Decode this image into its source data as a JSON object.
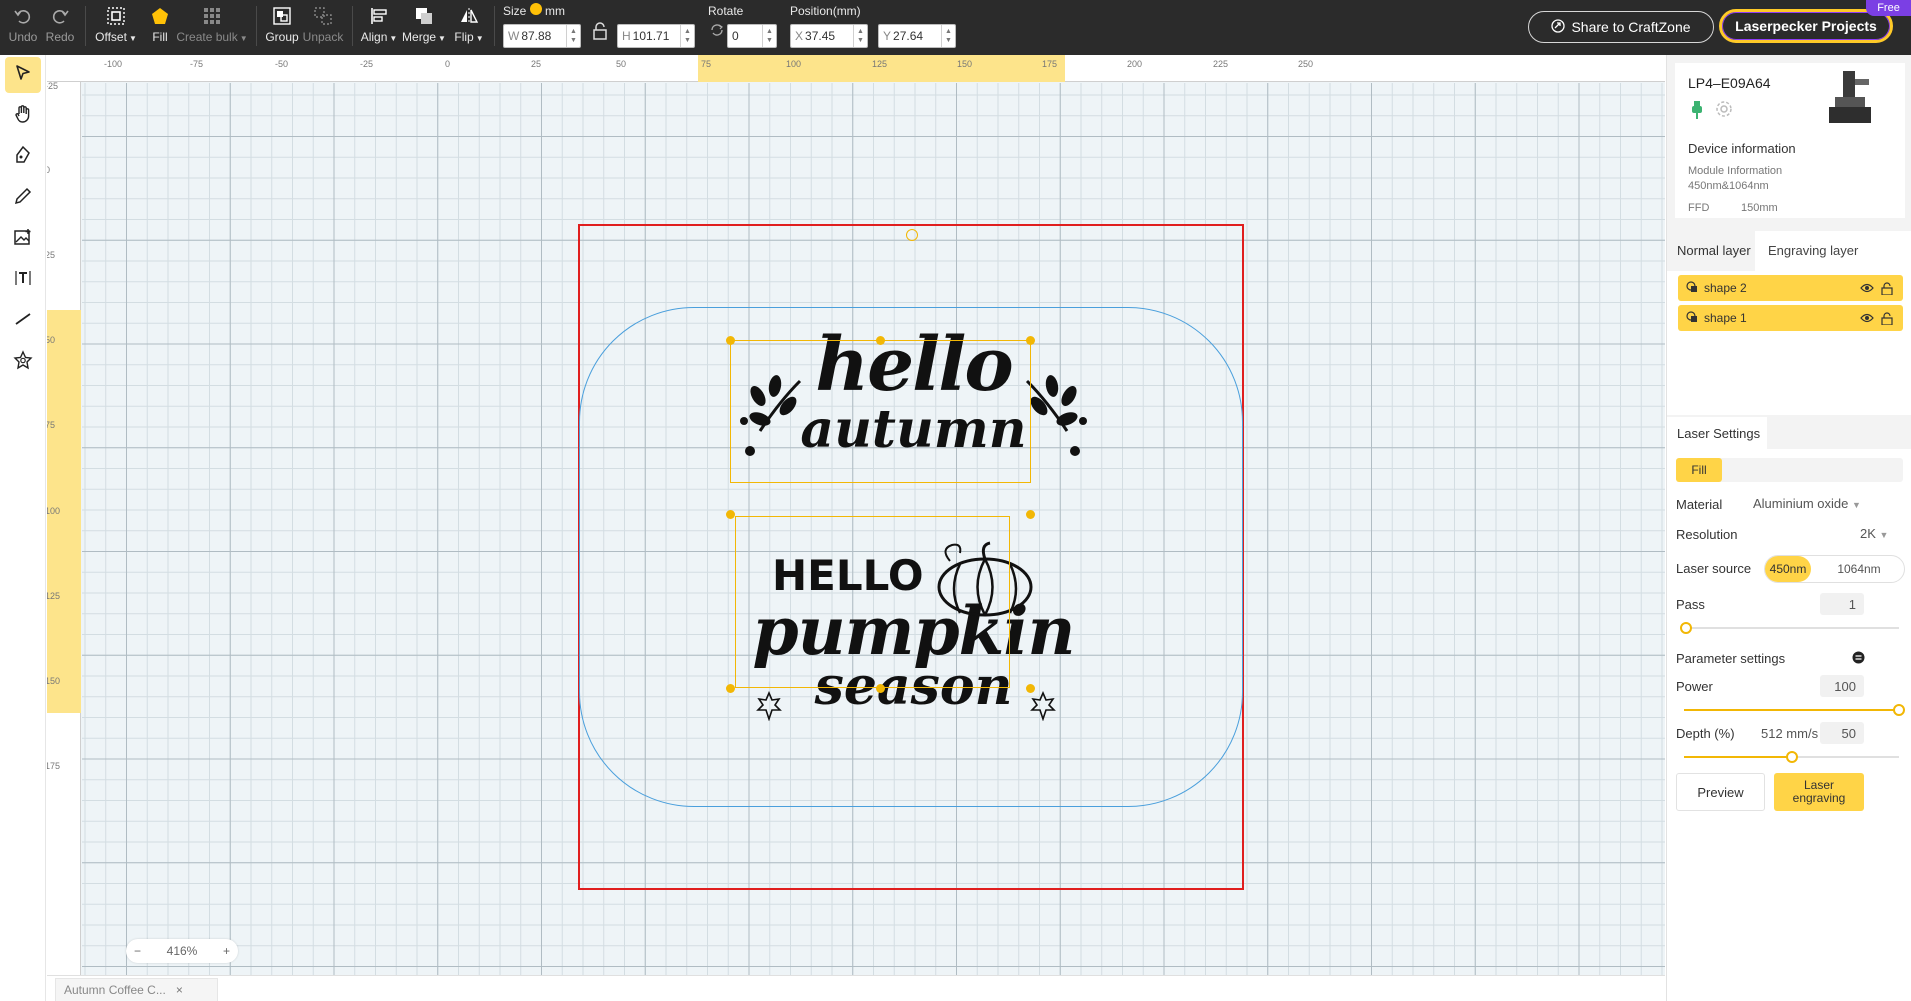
{
  "toolbar": {
    "undo": "Undo",
    "redo": "Redo",
    "offset": "Offset",
    "fill": "Fill",
    "create_bulk": "Create bulk",
    "group": "Group",
    "unpack": "Unpack",
    "align": "Align",
    "merge": "Merge",
    "flip": "Flip",
    "size_label": "Size",
    "unit": "mm",
    "width_prefix": "W",
    "width": "87.88",
    "height_prefix": "H",
    "height": "101.71",
    "rotate_label": "Rotate",
    "rotate": "0",
    "position_label": "Position(mm)",
    "x_prefix": "X",
    "x": "37.45",
    "y_prefix": "Y",
    "y": "27.64",
    "share": "Share to CraftZone",
    "projects": "Laserpecker Projects",
    "free": "Free"
  },
  "left_tools": {
    "icons": [
      "select-arrow-icon",
      "hand-icon",
      "pen-icon",
      "pencil-icon",
      "image-icon",
      "text-icon",
      "line-icon",
      "shapes-icon"
    ]
  },
  "canvas": {
    "ruler_top": [
      "-100",
      "-75",
      "-50",
      "-25",
      "0",
      "25",
      "50",
      "75",
      "100",
      "125",
      "150",
      "175",
      "200",
      "225",
      "250"
    ],
    "ruler_left": [
      "-25",
      "0",
      "25",
      "50",
      "75",
      "100",
      "125",
      "150",
      "175"
    ],
    "art_top_line1": "hello",
    "art_top_line2": "autumn",
    "art_bottom_line1": "HELLO",
    "art_bottom_line2": "pumpkin",
    "art_bottom_line3": "season",
    "zoom": "416%",
    "zoom_out": "−",
    "zoom_in": "+"
  },
  "file_tab": {
    "name": "Autumn Coffee C...",
    "close": "×"
  },
  "device": {
    "name": "LP4–E09A64",
    "info_title": "Device information",
    "module_label": "Module Information",
    "module_value": "450nm&1064nm",
    "ffd_label": "FFD",
    "ffd_value": "150mm"
  },
  "layers": {
    "tab_normal": "Normal layer",
    "tab_engraving": "Engraving layer",
    "items": [
      {
        "name": "shape 2"
      },
      {
        "name": "shape 1"
      }
    ]
  },
  "laser": {
    "title": "Laser Settings",
    "mode": "Fill",
    "material_label": "Material",
    "material": "Aluminium oxide",
    "resolution_label": "Resolution",
    "resolution": "2K",
    "source_label": "Laser source",
    "source_a": "450nm",
    "source_b": "1064nm",
    "pass_label": "Pass",
    "pass": "1",
    "param_title": "Parameter settings",
    "power_label": "Power",
    "power": "100",
    "power_level": 1.0,
    "depth_label": "Depth (%)",
    "speed": "512 mm/s",
    "depth": "50",
    "depth_level": 0.5,
    "preview": "Preview",
    "engrave": "Laser engraving"
  },
  "colors": {
    "accent": "#ffd447",
    "work_area": "#e01e1e",
    "outline": "#4a9fdc"
  }
}
